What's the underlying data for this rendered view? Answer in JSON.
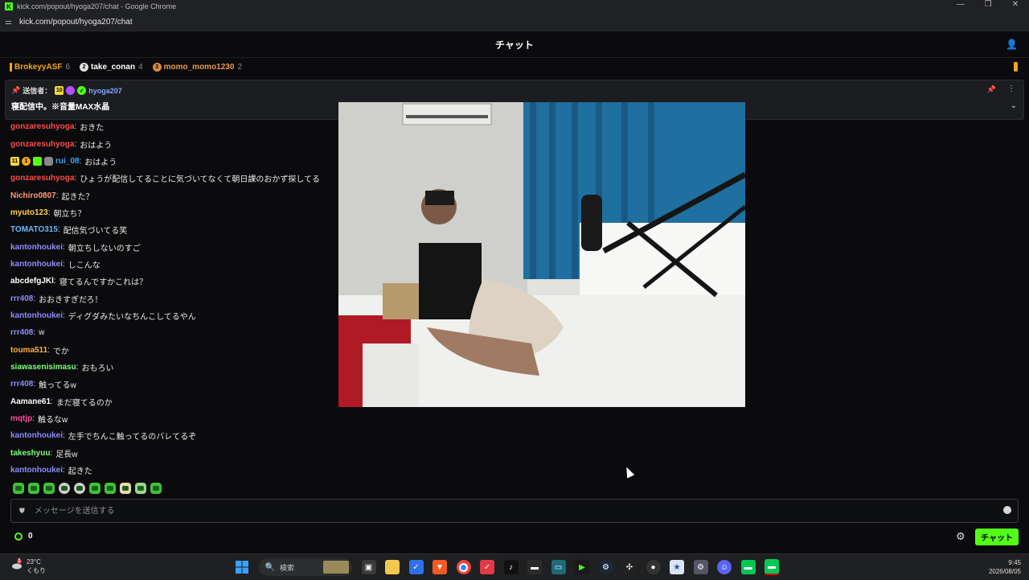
{
  "window": {
    "title": "kick.com/popout/hyoga207/chat - Google Chrome",
    "url": "kick.com/popout/hyoga207/chat"
  },
  "chat": {
    "header": "チャット",
    "leaderboard": [
      {
        "name": "BrokeyyASF",
        "count": "6",
        "color": "#f1a51b",
        "rank": ""
      },
      {
        "name": "take_conan",
        "count": "4",
        "color": "#ffffff",
        "rank": "2"
      },
      {
        "name": "momo_momo1230",
        "count": "2",
        "color": "#e89a4f",
        "rank": "3"
      }
    ],
    "pinned": {
      "label": "送信者：",
      "badge": "10",
      "sender": "hyoga207",
      "text": "寝配信中。※音量MAX水晶"
    },
    "messages": [
      {
        "user": "gonzaresuhyoga",
        "color": "#ff4b4b",
        "text": "おきた",
        "badges": []
      },
      {
        "user": "gonzaresuhyoga",
        "color": "#ff4b4b",
        "text": "おはよう",
        "badges": []
      },
      {
        "user": "rui_08",
        "color": "#3aa8ff",
        "text": "おはよう",
        "badges": [
          "11",
          "1"
        ]
      },
      {
        "user": "gonzaresuhyoga",
        "color": "#ff4b4b",
        "text": "ひょうが配信してることに気づいてなくて朝日課のおかず探してる",
        "badges": []
      },
      {
        "user": "Nichiro0807",
        "color": "#ff9b7a",
        "text": "起きた？",
        "badges": []
      },
      {
        "user": "myuto123",
        "color": "#ffd24a",
        "text": "朝立ち？",
        "badges": []
      },
      {
        "user": "TOMATO315",
        "color": "#6fb6ff",
        "text": "配信気づいてる笑",
        "badges": []
      },
      {
        "user": "kantonhoukei",
        "color": "#8c8cff",
        "text": "朝立ちしないのすご",
        "badges": []
      },
      {
        "user": "kantonhoukei",
        "color": "#8c8cff",
        "text": "しこんな",
        "badges": []
      },
      {
        "user": "abcdefgJKl",
        "color": "#ffffff",
        "text": "寝てるんですかこれは？",
        "badges": []
      },
      {
        "user": "rrr408",
        "color": "#8c8cff",
        "text": "おおきすぎだろ！",
        "badges": []
      },
      {
        "user": "kantonhoukei",
        "color": "#8c8cff",
        "text": "ディグダみたいなちんこしてるやん",
        "badges": []
      },
      {
        "user": "rrr408",
        "color": "#8c8cff",
        "text": "w",
        "badges": []
      },
      {
        "user": "touma511",
        "color": "#ffb23e",
        "text": "でか",
        "badges": []
      },
      {
        "user": "siawasenisimasu",
        "color": "#7dff7a",
        "text": "おもろい",
        "badges": []
      },
      {
        "user": "rrr408",
        "color": "#8c8cff",
        "text": "触ってるw",
        "badges": []
      },
      {
        "user": "Aamane61",
        "color": "#ffffff",
        "text": "まだ寝てるのか",
        "badges": []
      },
      {
        "user": "mqtjp",
        "color": "#ff4fa0",
        "text": "触るなw",
        "badges": []
      },
      {
        "user": "kantonhoukei",
        "color": "#8c8cff",
        "text": "左手でちんこ触ってるのバレてるぞ",
        "badges": []
      },
      {
        "user": "takeshyuu",
        "color": "#7dff7a",
        "text": "足長w",
        "badges": []
      },
      {
        "user": "kantonhoukei",
        "color": "#8c8cff",
        "text": "起きた",
        "badges": []
      }
    ],
    "emote_count": 10,
    "input_placeholder": "メッセージを送信する",
    "points": "0",
    "send_label": "チャット"
  },
  "taskbar": {
    "temperature": "23°C",
    "weather": "くもり",
    "weather_badge": "1",
    "search_placeholder": "検索",
    "time": "9:45",
    "date": "2026/08/05",
    "apps": [
      "file-explorer-icon",
      "files-icon",
      "todo-icon",
      "brave-icon",
      "chrome-icon",
      "app-icon",
      "tiktok-icon",
      "terminal-icon",
      "app2-icon",
      "app3-icon",
      "steam-icon",
      "davinci-icon",
      "obs-icon",
      "photos-icon",
      "settings-icon",
      "discord-icon",
      "line-icon",
      "line2-icon"
    ]
  }
}
